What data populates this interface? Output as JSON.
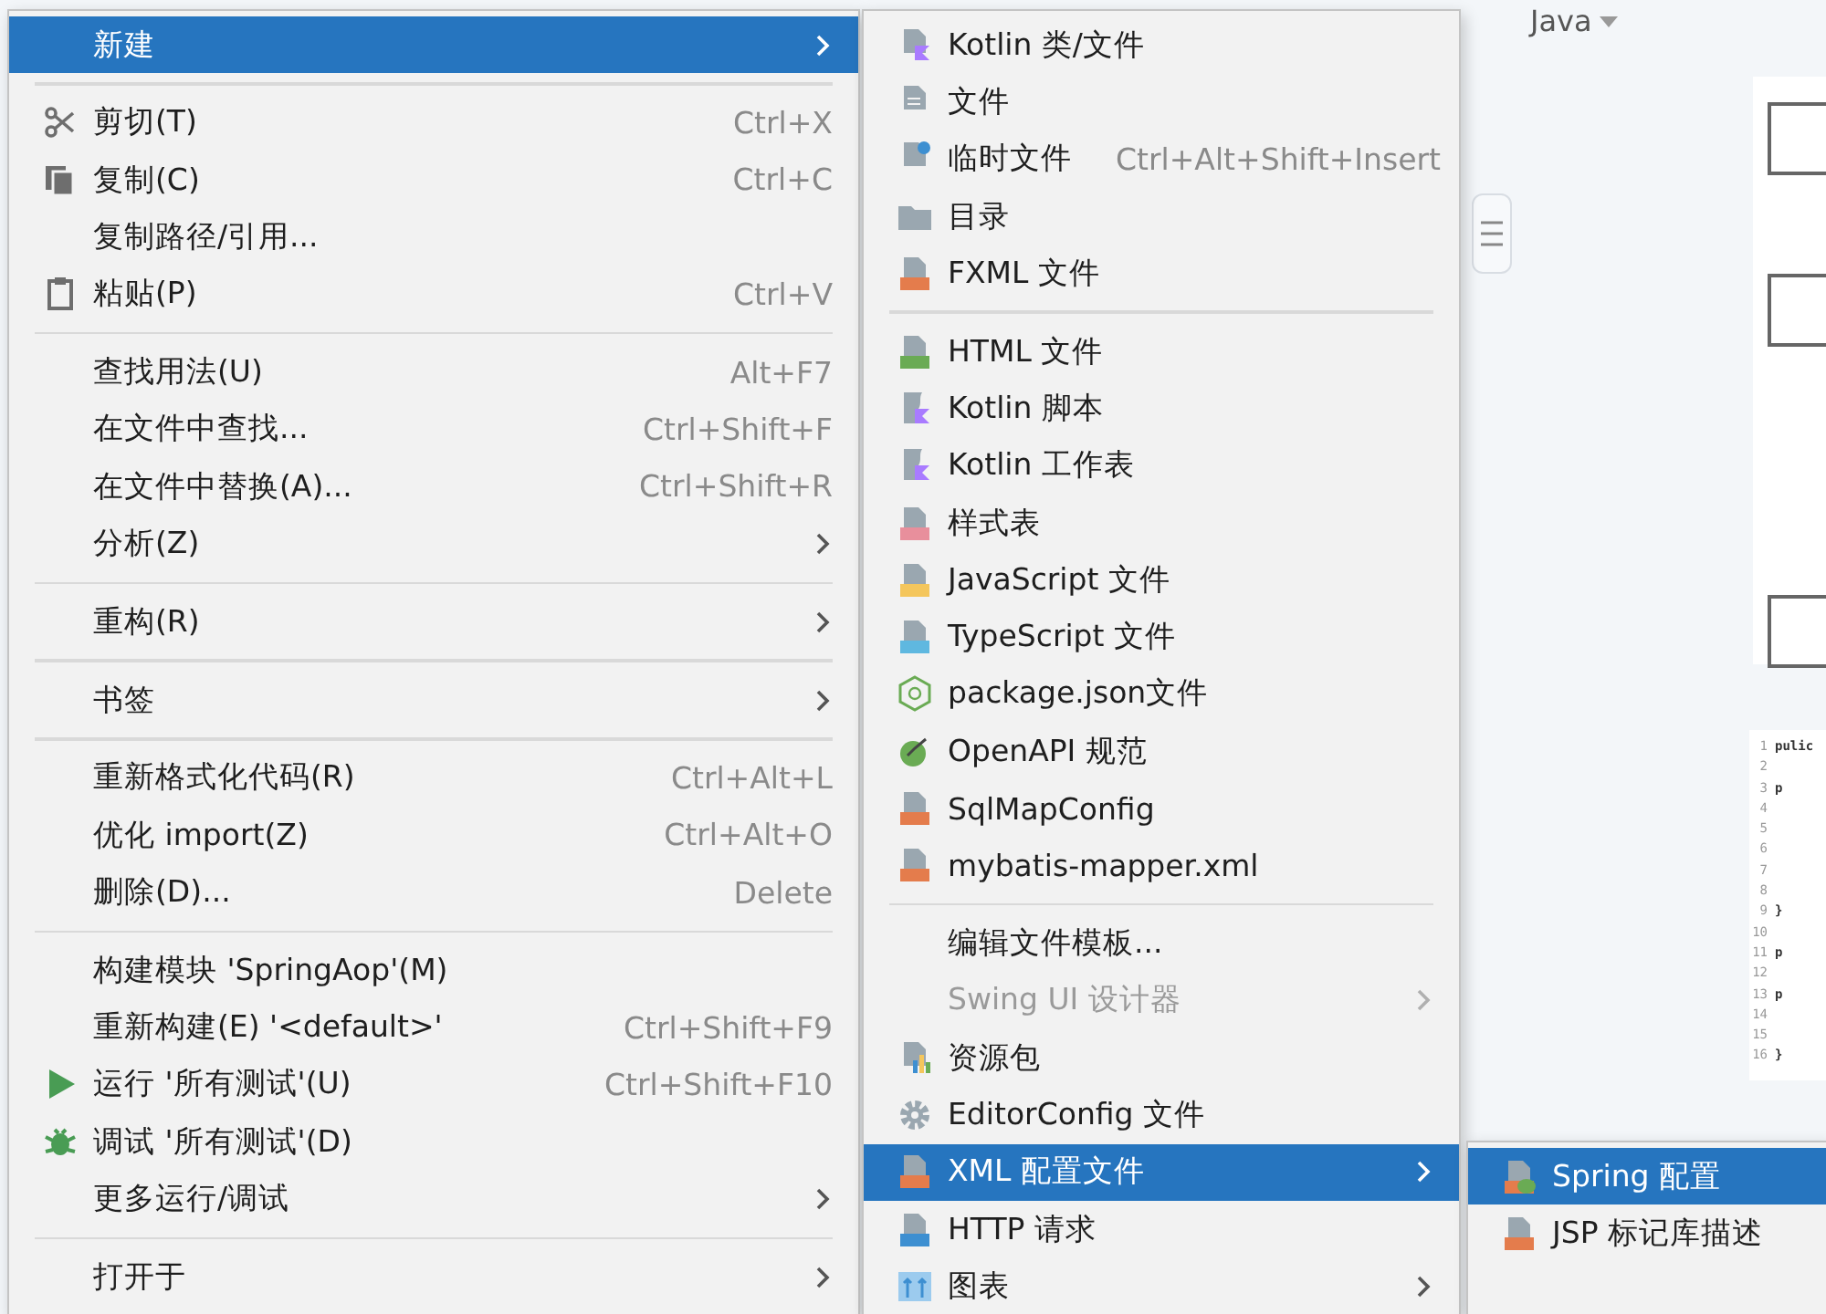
{
  "editor": {
    "language": "Java",
    "code_lines": [
      {
        "number": "1",
        "text": "pulic"
      },
      {
        "number": "2"
      },
      {
        "number": "3",
        "text": "p"
      },
      {
        "number": "4"
      },
      {
        "number": "5"
      },
      {
        "number": "6"
      },
      {
        "number": "7"
      },
      {
        "number": "8"
      },
      {
        "number": "9",
        "text": "}"
      },
      {
        "number": "10"
      },
      {
        "number": "11",
        "text": "p"
      },
      {
        "number": "12"
      },
      {
        "number": "13",
        "text": "p"
      },
      {
        "number": "14"
      },
      {
        "number": "15"
      },
      {
        "number": "16",
        "text": "}"
      }
    ]
  },
  "menus": [
    {
      "items": [
        {
          "kind": "item",
          "label": "新建",
          "selected": true,
          "disabled": false,
          "submenu": true
        },
        {
          "kind": "separator"
        },
        {
          "kind": "scissors",
          "label": "剪切(T)",
          "shortcut": "Ctrl+X",
          "selected": false,
          "disabled": false,
          "submenu": false
        },
        {
          "kind": "copy",
          "label": "复制(C)",
          "shortcut": "Ctrl+C",
          "selected": false,
          "disabled": false,
          "submenu": false
        },
        {
          "kind": "item",
          "label": "复制路径/引用...",
          "selected": false,
          "disabled": false,
          "submenu": false
        },
        {
          "kind": "clipboard",
          "label": "粘贴(P)",
          "shortcut": "Ctrl+V",
          "selected": false,
          "disabled": false,
          "submenu": false
        },
        {
          "kind": "separator"
        },
        {
          "kind": "item",
          "label": "查找用法(U)",
          "shortcut": "Alt+F7",
          "selected": false,
          "disabled": false,
          "submenu": false
        },
        {
          "kind": "item",
          "label": "在文件中查找...",
          "shortcut": "Ctrl+Shift+F",
          "selected": false,
          "disabled": false,
          "submenu": false
        },
        {
          "kind": "item",
          "label": "在文件中替换(A)...",
          "shortcut": "Ctrl+Shift+R",
          "selected": false,
          "disabled": false,
          "submenu": false
        },
        {
          "kind": "item",
          "label": "分析(Z)",
          "selected": false,
          "disabled": false,
          "submenu": true
        },
        {
          "kind": "separator"
        },
        {
          "kind": "item",
          "label": "重构(R)",
          "selected": false,
          "disabled": false,
          "submenu": true
        },
        {
          "kind": "separator"
        },
        {
          "kind": "item",
          "label": "书签",
          "selected": false,
          "disabled": false,
          "submenu": true
        },
        {
          "kind": "separator"
        },
        {
          "kind": "item",
          "label": "重新格式化代码(R)",
          "shortcut": "Ctrl+Alt+L",
          "selected": false,
          "disabled": false,
          "submenu": false
        },
        {
          "kind": "item",
          "label": "优化 import(Z)",
          "shortcut": "Ctrl+Alt+O",
          "selected": false,
          "disabled": false,
          "submenu": false
        },
        {
          "kind": "item",
          "label": "删除(D)...",
          "shortcut": "Delete",
          "selected": false,
          "disabled": false,
          "submenu": false
        },
        {
          "kind": "separator"
        },
        {
          "kind": "item",
          "label": "构建模块 'SpringAop'(M)",
          "selected": false,
          "disabled": false,
          "submenu": false
        },
        {
          "kind": "item",
          "label": "重新构建(E) '<default>'",
          "shortcut": "Ctrl+Shift+F9",
          "selected": false,
          "disabled": false,
          "submenu": false
        },
        {
          "kind": "play",
          "label": "运行 '所有测试'(U)",
          "shortcut": "Ctrl+Shift+F10",
          "selected": false,
          "disabled": false,
          "submenu": false
        },
        {
          "kind": "bug",
          "label": "调试 '所有测试'(D)",
          "selected": false,
          "disabled": false,
          "submenu": false
        },
        {
          "kind": "item",
          "label": "更多运行/调试",
          "selected": false,
          "disabled": false,
          "submenu": true
        },
        {
          "kind": "separator"
        },
        {
          "kind": "item",
          "label": "打开于",
          "selected": false,
          "disabled": false,
          "submenu": true
        }
      ]
    },
    {
      "items": [
        {
          "kind": "kotlin",
          "label": "Kotlin 类/文件",
          "selected": false,
          "disabled": false,
          "submenu": false
        },
        {
          "kind": "file",
          "label": "文件",
          "selected": false,
          "disabled": false,
          "submenu": false
        },
        {
          "kind": "scratch",
          "label": "临时文件",
          "shortcut": "Ctrl+Alt+Shift+Insert",
          "selected": false,
          "disabled": false,
          "submenu": false
        },
        {
          "kind": "folder",
          "label": "目录",
          "selected": false,
          "disabled": false,
          "submenu": false
        },
        {
          "kind": "xml",
          "label": "FXML 文件",
          "selected": false,
          "disabled": false,
          "submenu": false
        },
        {
          "kind": "separator"
        },
        {
          "kind": "html",
          "label": "HTML 文件",
          "selected": false,
          "disabled": false,
          "submenu": false
        },
        {
          "kind": "kotlin-script",
          "label": "Kotlin 脚本",
          "selected": false,
          "disabled": false,
          "submenu": false
        },
        {
          "kind": "kotlin-script",
          "label": "Kotlin 工作表",
          "selected": false,
          "disabled": false,
          "submenu": false
        },
        {
          "kind": "css",
          "label": "样式表",
          "selected": false,
          "disabled": false,
          "submenu": false
        },
        {
          "kind": "js",
          "label": "JavaScript 文件",
          "selected": false,
          "disabled": false,
          "submenu": false
        },
        {
          "kind": "ts",
          "label": "TypeScript 文件",
          "selected": false,
          "disabled": false,
          "submenu": false
        },
        {
          "kind": "hexagon",
          "label": "package.json文件",
          "selected": false,
          "disabled": false,
          "submenu": false
        },
        {
          "kind": "openapi",
          "label": "OpenAPI 规范",
          "selected": false,
          "disabled": false,
          "submenu": false
        },
        {
          "kind": "xml",
          "label": "SqlMapConfig",
          "selected": false,
          "disabled": false,
          "submenu": false
        },
        {
          "kind": "xml",
          "label": "mybatis-mapper.xml",
          "selected": false,
          "disabled": false,
          "submenu": false
        },
        {
          "kind": "separator"
        },
        {
          "kind": "item",
          "label": "编辑文件模板...",
          "selected": false,
          "disabled": false,
          "submenu": false
        },
        {
          "kind": "item",
          "label": "Swing UI 设计器",
          "selected": false,
          "disabled": true,
          "submenu": true
        },
        {
          "kind": "bundle",
          "label": "资源包",
          "selected": false,
          "disabled": false,
          "submenu": false
        },
        {
          "kind": "gear",
          "label": "EditorConfig 文件",
          "selected": false,
          "disabled": false,
          "submenu": false
        },
        {
          "kind": "xml",
          "label": "XML 配置文件",
          "selected": true,
          "disabled": false,
          "submenu": true
        },
        {
          "kind": "api",
          "label": "HTTP 请求",
          "selected": false,
          "disabled": false,
          "submenu": false
        },
        {
          "kind": "diagram",
          "label": "图表",
          "selected": false,
          "disabled": false,
          "submenu": true
        }
      ]
    },
    {
      "items": [
        {
          "kind": "spring",
          "label": "Spring 配置",
          "selected": true,
          "disabled": false,
          "submenu": false
        },
        {
          "kind": "xml",
          "label": "JSP 标记库描述",
          "selected": false,
          "disabled": false,
          "submenu": false
        }
      ]
    }
  ]
}
